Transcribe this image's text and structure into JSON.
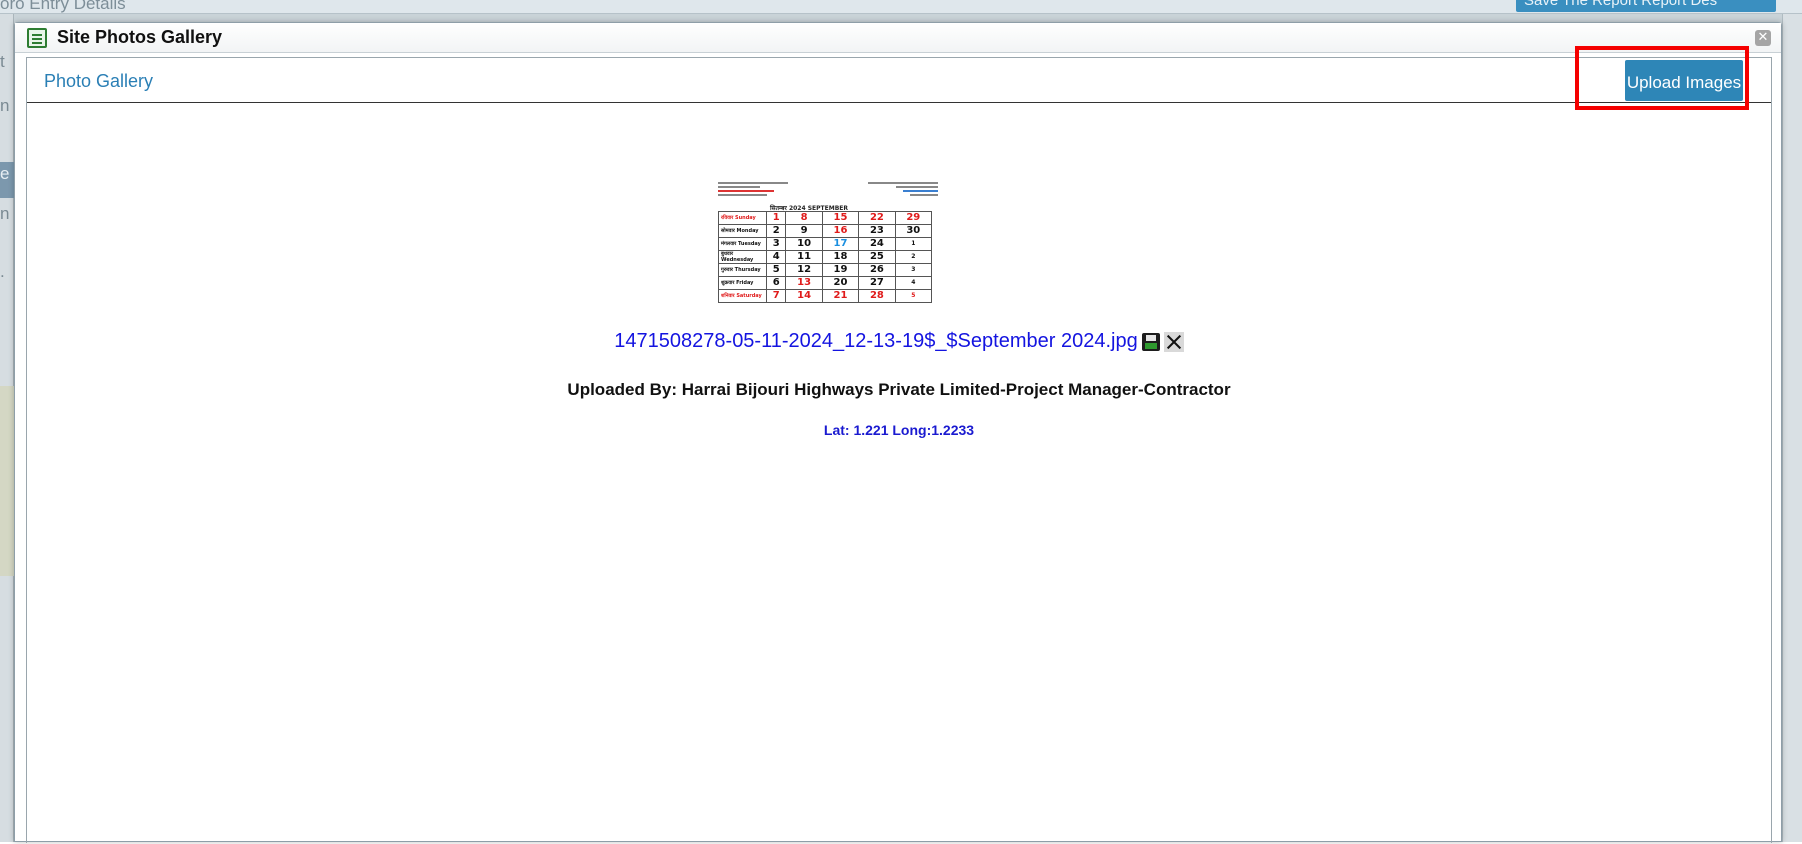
{
  "background": {
    "title": "oro Entry Details",
    "button_label": "Save The Report Report Des",
    "left_glyphs": [
      "t",
      "n",
      "e",
      "n",
      "."
    ]
  },
  "dialog": {
    "title": "Site Photos Gallery",
    "close_label": "✕",
    "tab_label": "Photo Gallery",
    "upload_button_label": "Upload Images"
  },
  "photo": {
    "file_name": "1471508278-05-11-2024_12-13-19$_$September 2024.jpg",
    "uploaded_by": "Uploaded By: Harrai Bijouri Highways Private Limited-Project Manager-Contractor",
    "lat_long": "Lat: 1.221 Long:1.2233"
  },
  "thumbnail": {
    "month_label": "सितम्बर 2024 SEPTEMBER",
    "rows": [
      {
        "day": "रविवार Sunday",
        "dates": [
          "1",
          "8",
          "15",
          "22",
          "29"
        ],
        "red": true
      },
      {
        "day": "सोमवार Monday",
        "dates": [
          "2",
          "9",
          "16",
          "23",
          "30"
        ]
      },
      {
        "day": "मंगलवार Tuesday",
        "dates": [
          "3",
          "10",
          "17",
          "24",
          "1"
        ]
      },
      {
        "day": "बुधवार Wednesday",
        "dates": [
          "4",
          "11",
          "18",
          "25",
          "2"
        ]
      },
      {
        "day": "गुरुवार Thursday",
        "dates": [
          "5",
          "12",
          "19",
          "26",
          "3"
        ]
      },
      {
        "day": "शुक्रवार Friday",
        "dates": [
          "6",
          "13",
          "20",
          "27",
          "4"
        ]
      },
      {
        "day": "शनिवार Saturday",
        "dates": [
          "7",
          "14",
          "21",
          "28",
          "5"
        ],
        "red": true
      }
    ]
  },
  "colors": {
    "accent": "#2e86b7",
    "highlight": "#f50000",
    "link": "#1414e0"
  },
  "icons": [
    "sheet-icon",
    "close-icon",
    "save-icon",
    "delete-icon"
  ]
}
